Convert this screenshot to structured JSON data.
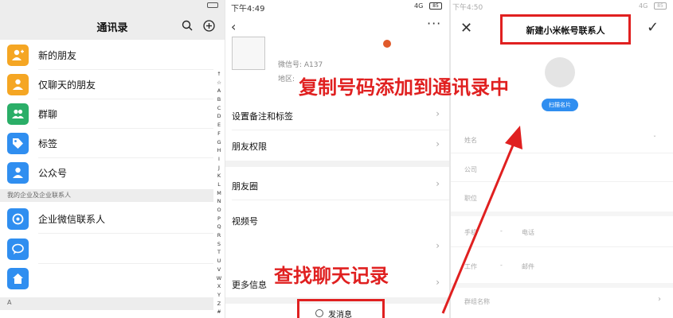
{
  "contacts_panel": {
    "title": "通讯录",
    "items": [
      {
        "label": "新的朋友",
        "color": "#f5a623"
      },
      {
        "label": "仅聊天的朋友",
        "color": "#f5a623"
      },
      {
        "label": "群聊",
        "color": "#2aae67"
      },
      {
        "label": "标签",
        "color": "#2f8ef0"
      },
      {
        "label": "公众号",
        "color": "#2f8ef0"
      }
    ],
    "section_label": "我的企业及企业联系人",
    "enterprise_item": {
      "label": "企业微信联系人",
      "color": "#2f8ef0"
    },
    "bottom_section": "A",
    "alphabet": [
      "↑",
      "☆",
      "A",
      "B",
      "C",
      "D",
      "E",
      "F",
      "G",
      "H",
      "I",
      "J",
      "K",
      "L",
      "M",
      "N",
      "O",
      "P",
      "Q",
      "R",
      "S",
      "T",
      "U",
      "V",
      "W",
      "X",
      "Y",
      "Z",
      "#"
    ]
  },
  "profile_panel": {
    "time": "下午4:49",
    "network": "4G",
    "battery": "85",
    "wechat_id": "微信号: A137",
    "region": "地区:",
    "items": {
      "remarks": "设置备注和标签",
      "permissions": "朋友权限",
      "moments": "朋友圈",
      "channels": "视频号",
      "more_info": "更多信息"
    },
    "send_message": "发消息"
  },
  "new_contact_panel": {
    "time": "下午4:50",
    "network": "4G",
    "battery": "85",
    "title": "新建小米帐号联系人",
    "scan_card": "扫描名片",
    "fields": {
      "name": "姓名",
      "company": "公司",
      "position": "职位",
      "phone": "手机",
      "phone_placeholder": "电话",
      "work": "工作",
      "work_placeholder": "邮件",
      "group": "群组名称"
    }
  },
  "annotations": {
    "copy_number": "复制号码添加到通讯录中",
    "find_chat": "查找聊天记录"
  }
}
